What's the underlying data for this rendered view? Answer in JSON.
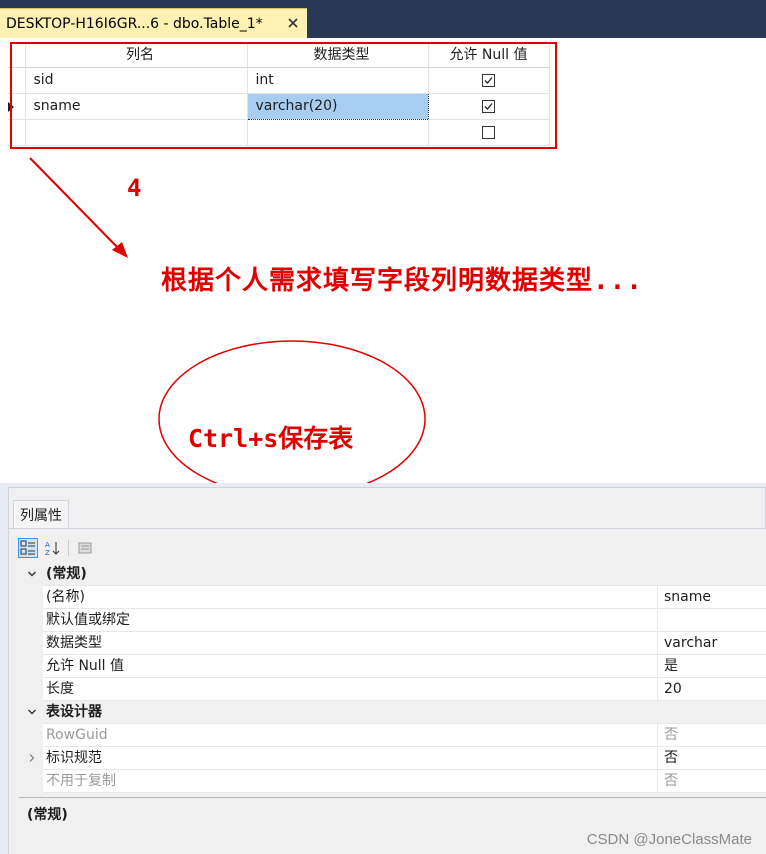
{
  "tab": {
    "title": "DESKTOP-H16I6GR...6 - dbo.Table_1*"
  },
  "grid": {
    "headers": {
      "name": "列名",
      "type": "数据类型",
      "null": "允许 Null 值"
    },
    "rows": [
      {
        "name": "sid",
        "type": "int",
        "allow_null": true
      },
      {
        "name": "sname",
        "type": "varchar(20)",
        "allow_null": true
      },
      {
        "name": "",
        "type": "",
        "allow_null": false
      }
    ]
  },
  "annotations": {
    "step": "4",
    "hint": "根据个人需求填写字段列明数据类型...",
    "save": "Ctrl+s保存表",
    "color": "#e00000"
  },
  "properties": {
    "tab_label": "列属性",
    "sections": [
      {
        "title": "(常规)",
        "rows": [
          {
            "label": "(名称)",
            "value": "sname"
          },
          {
            "label": "默认值或绑定",
            "value": ""
          },
          {
            "label": "数据类型",
            "value": "varchar"
          },
          {
            "label": "允许 Null 值",
            "value": "是"
          },
          {
            "label": "长度",
            "value": "20"
          }
        ]
      },
      {
        "title": "表设计器",
        "rows": [
          {
            "label": "RowGuid",
            "value": "否"
          },
          {
            "label": "标识规范",
            "value": "否"
          },
          {
            "label": "不用于复制",
            "value": "否"
          }
        ]
      }
    ],
    "description_title": "(常规)"
  },
  "watermark": "CSDN @JoneClassMate"
}
